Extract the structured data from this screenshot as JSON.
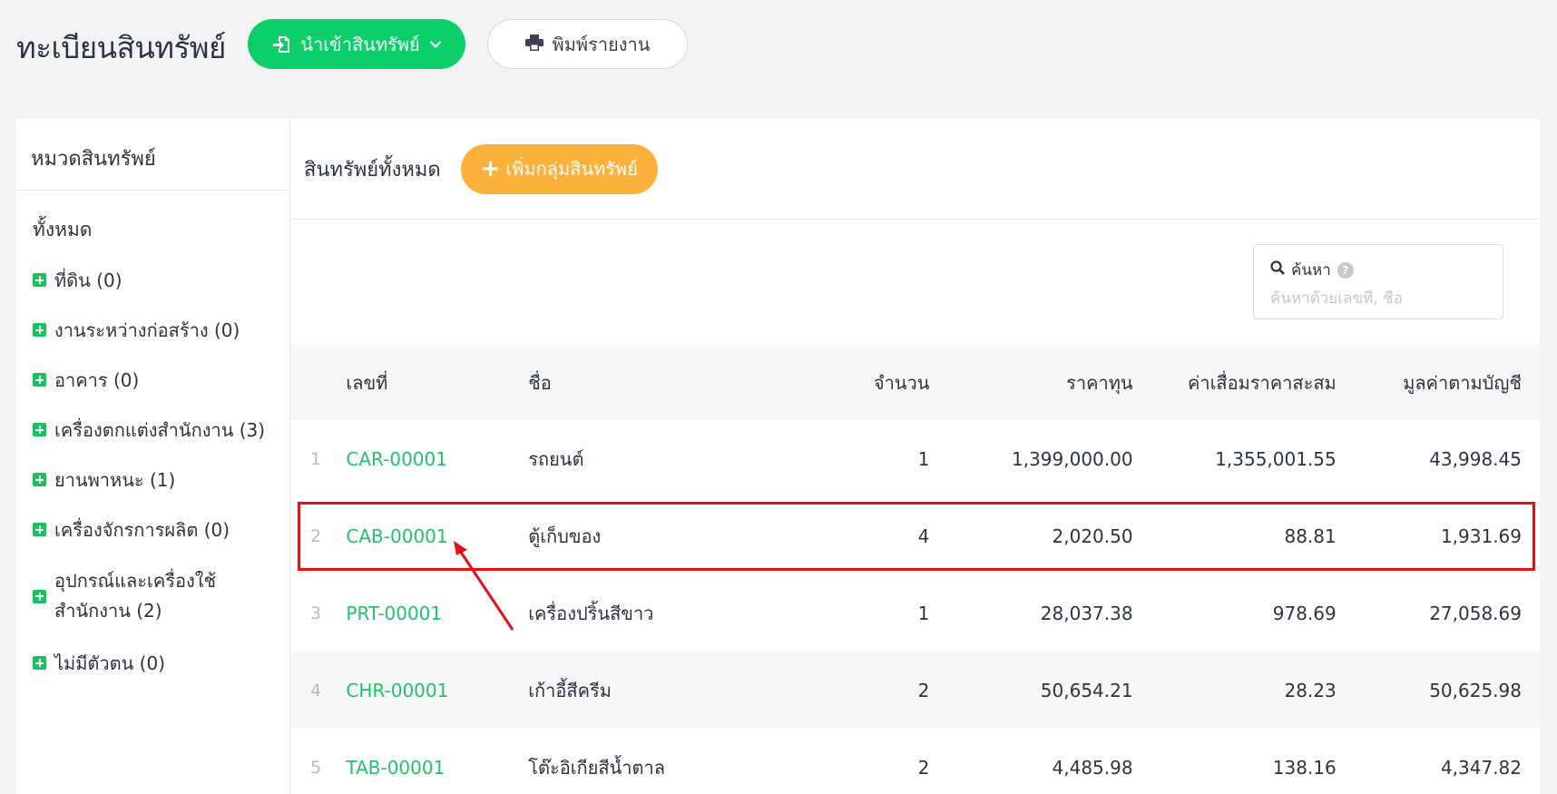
{
  "header": {
    "title": "ทะเบียนสินทรัพย์",
    "import_label": "นำเข้าสินทรัพย์",
    "print_label": "พิมพ์รายงาน"
  },
  "sidebar": {
    "title": "หมวดสินทรัพย์",
    "all_label": "ทั้งหมด",
    "categories": [
      {
        "label": "ที่ดิน (0)"
      },
      {
        "label": "งานระหว่างก่อสร้าง (0)"
      },
      {
        "label": "อาคาร (0)"
      },
      {
        "label": "เครื่องตกแต่งสำนักงาน (3)"
      },
      {
        "label": "ยานพาหนะ (1)"
      },
      {
        "label": "เครื่องจักรการผลิต (0)"
      },
      {
        "label": "อุปกรณ์และเครื่องใช้ สำนักงาน (2)"
      },
      {
        "label": "ไม่มีตัวตน (0)"
      }
    ]
  },
  "main": {
    "title": "สินทรัพย์ทั้งหมด",
    "add_group_label": "เพิ่มกลุ่มสินทรัพย์",
    "search": {
      "label": "ค้นหา",
      "placeholder": "ค้นหาด้วยเลขที่, ชื่อ"
    },
    "table": {
      "headers": {
        "code": "เลขที่",
        "name": "ชื่อ",
        "qty": "จำนวน",
        "cost": "ราคาทุน",
        "depreciation": "ค่าเสื่อมราคาสะสม",
        "book_value": "มูลค่าตามบัญชี"
      },
      "rows": [
        {
          "idx": "1",
          "code": "CAR-00001",
          "name": "รถยนต์",
          "qty": "1",
          "cost": "1,399,000.00",
          "depreciation": "1,355,001.55",
          "book_value": "43,998.45"
        },
        {
          "idx": "2",
          "code": "CAB-00001",
          "name": "ตู้เก็บของ",
          "qty": "4",
          "cost": "2,020.50",
          "depreciation": "88.81",
          "book_value": "1,931.69"
        },
        {
          "idx": "3",
          "code": "PRT-00001",
          "name": "เครื่องปริ้นสีขาว",
          "qty": "1",
          "cost": "28,037.38",
          "depreciation": "978.69",
          "book_value": "27,058.69"
        },
        {
          "idx": "4",
          "code": "CHR-00001",
          "name": "เก้าอี้สีครีม",
          "qty": "2",
          "cost": "50,654.21",
          "depreciation": "28.23",
          "book_value": "50,625.98"
        },
        {
          "idx": "5",
          "code": "TAB-00001",
          "name": "โต๊ะอิเกียสีน้ำตาล",
          "qty": "2",
          "cost": "4,485.98",
          "depreciation": "138.16",
          "book_value": "4,347.82"
        }
      ]
    }
  },
  "colors": {
    "primary_green": "#0ccf6a",
    "code_green": "#1fc36b",
    "accent_orange": "#fbb13a",
    "annotation_red": "#e50f16"
  }
}
